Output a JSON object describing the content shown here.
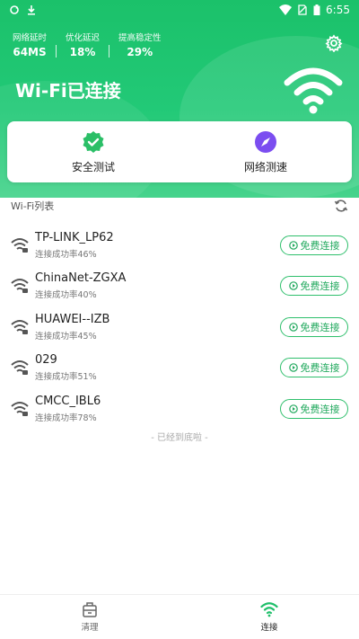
{
  "status_bar": {
    "time": "6:55"
  },
  "stats": [
    {
      "label": "网络延时",
      "value": "64MS"
    },
    {
      "label": "优化延迟",
      "value": "18%"
    },
    {
      "label": "提高稳定性",
      "value": "29%"
    }
  ],
  "header": {
    "title": "Wi-Fi已连接"
  },
  "actions": [
    {
      "label": "安全测试",
      "icon": "shield-check-icon"
    },
    {
      "label": "网络测速",
      "icon": "speed-compass-icon"
    }
  ],
  "list": {
    "title": "Wi-Fi列表",
    "connect_label": "免费连接",
    "networks": [
      {
        "name": "TP-LINK_LP62",
        "rate": "连接成功率46%"
      },
      {
        "name": "ChinaNet-ZGXA",
        "rate": "连接成功率40%"
      },
      {
        "name": "HUAWEI--IZB",
        "rate": "连接成功率45%"
      },
      {
        "name": "029",
        "rate": "连接成功率51%"
      },
      {
        "name": "CMCC_IBL6",
        "rate": "连接成功率78%"
      }
    ],
    "end_note": "- 已经到底啦 -"
  },
  "bottom_nav": [
    {
      "label": "清理",
      "icon": "clean-icon",
      "active": false
    },
    {
      "label": "连接",
      "icon": "wifi-icon",
      "active": true
    }
  ],
  "colors": {
    "brand_green": "#22c977",
    "accent_purple": "#7b4df0"
  }
}
